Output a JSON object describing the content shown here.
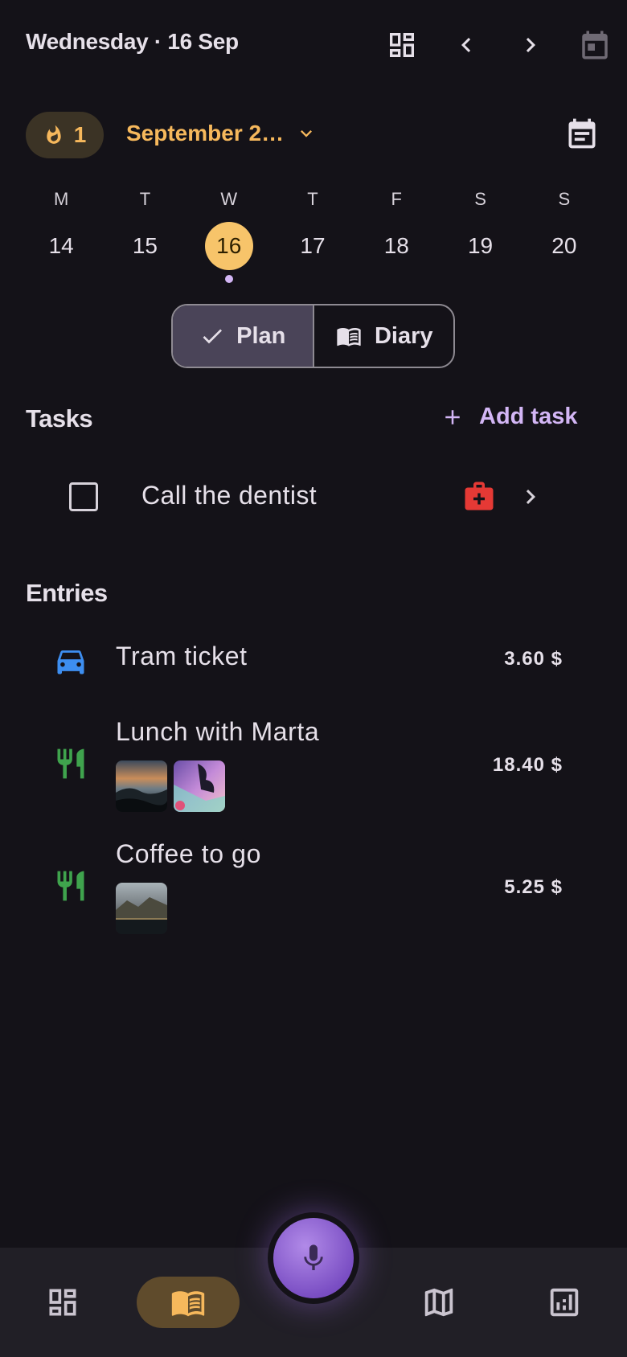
{
  "header": {
    "title": "Wednesday · 16 Sep",
    "icons": [
      "dashboard-icon",
      "chevron-left-icon",
      "chevron-right-icon",
      "calendar-today-icon"
    ]
  },
  "streak": {
    "count": "1",
    "icon": "fire-icon"
  },
  "month_selector": {
    "label": "September 2…",
    "icon": "chevron-down-icon"
  },
  "week": [
    {
      "letter": "M",
      "num": "14",
      "selected": false
    },
    {
      "letter": "T",
      "num": "15",
      "selected": false
    },
    {
      "letter": "W",
      "num": "16",
      "selected": true
    },
    {
      "letter": "T",
      "num": "17",
      "selected": false
    },
    {
      "letter": "F",
      "num": "18",
      "selected": false
    },
    {
      "letter": "S",
      "num": "19",
      "selected": false
    },
    {
      "letter": "S",
      "num": "20",
      "selected": false
    }
  ],
  "mode_toggle": {
    "plan": "Plan",
    "diary": "Diary",
    "active": "plan"
  },
  "tasks": {
    "title": "Tasks",
    "add_label": "Add task",
    "items": [
      {
        "label": "Call the dentist",
        "checked": false,
        "category_icon": "medical-kit-icon"
      }
    ]
  },
  "entries": {
    "title": "Entries",
    "items": [
      {
        "title": "Tram ticket",
        "amount": "3.60 $",
        "icon": "car-icon",
        "color": "#3d8ef0"
      },
      {
        "title": "Lunch with Marta",
        "amount": "18.40 $",
        "icon": "restaurant-icon",
        "color": "#3fa34d"
      },
      {
        "title": "Coffee to go",
        "amount": "5.25 $",
        "icon": "restaurant-icon",
        "color": "#3fa34d"
      }
    ]
  },
  "bottom_nav": {
    "items": [
      "dashboard-icon",
      "diary-icon",
      "map-icon",
      "stats-icon"
    ],
    "active": "diary-icon",
    "fab": "microphone-icon"
  },
  "colors": {
    "background": "#141218",
    "accent": "#f6b85c",
    "primary": "#d3b6f5"
  }
}
